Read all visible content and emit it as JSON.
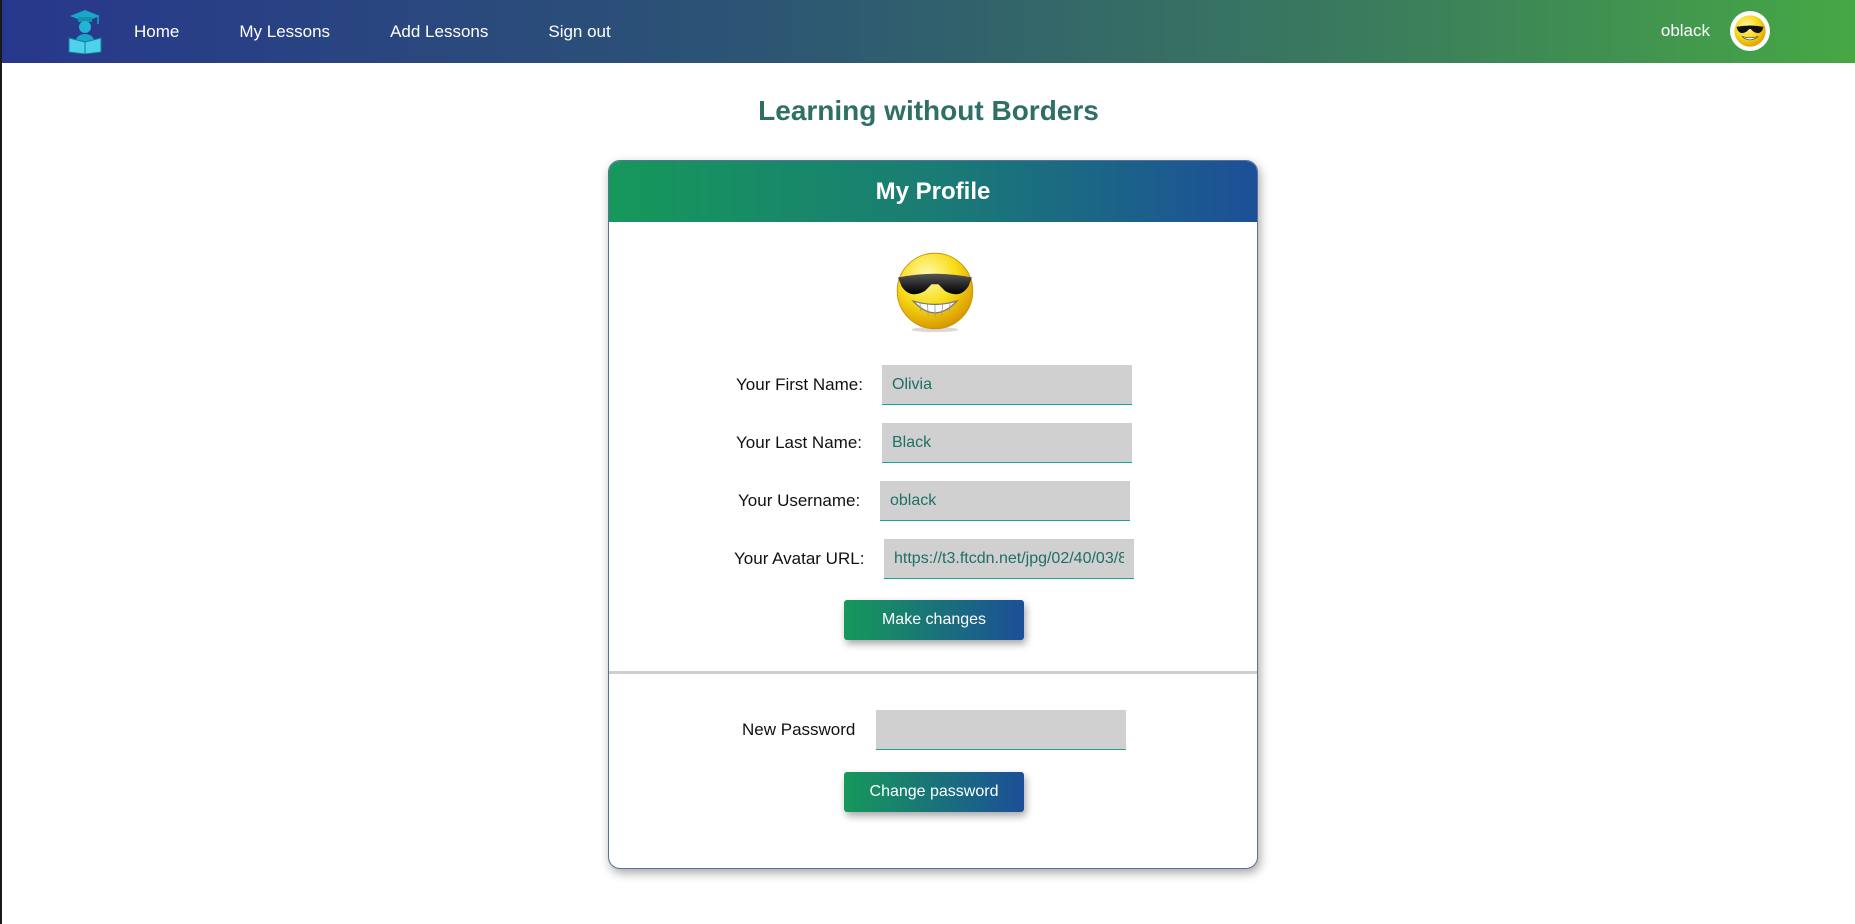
{
  "nav": {
    "links": [
      "Home",
      "My Lessons",
      "Add Lessons",
      "Sign out"
    ],
    "username": "oblack",
    "logo_icon": "graduate-reading-icon",
    "avatar_icon": "sunglasses-smiley-icon"
  },
  "page": {
    "title": "Learning without Borders"
  },
  "profile": {
    "title": "My Profile",
    "avatar_icon": "sunglasses-smiley-icon",
    "fields": {
      "first_name": {
        "label": "Your First Name:",
        "value": "Olivia"
      },
      "last_name": {
        "label": "Your Last Name:",
        "value": "Black"
      },
      "username": {
        "label": "Your Username:",
        "value": "oblack"
      },
      "avatar_url": {
        "label": "Your Avatar URL:",
        "value": "https://t3.ftcdn.net/jpg/02/40/03/8"
      }
    },
    "make_changes_label": "Make changes",
    "password": {
      "label": "New Password",
      "value": ""
    },
    "change_password_label": "Change password"
  },
  "colors": {
    "nav_gradient_start": "#27378c",
    "nav_gradient_end": "#46a844",
    "title": "#2f6f66",
    "button_gradient_start": "#16985a",
    "button_gradient_end": "#1c4f98",
    "input_bg": "#d0d0d0",
    "input_text": "#1f6f66"
  }
}
